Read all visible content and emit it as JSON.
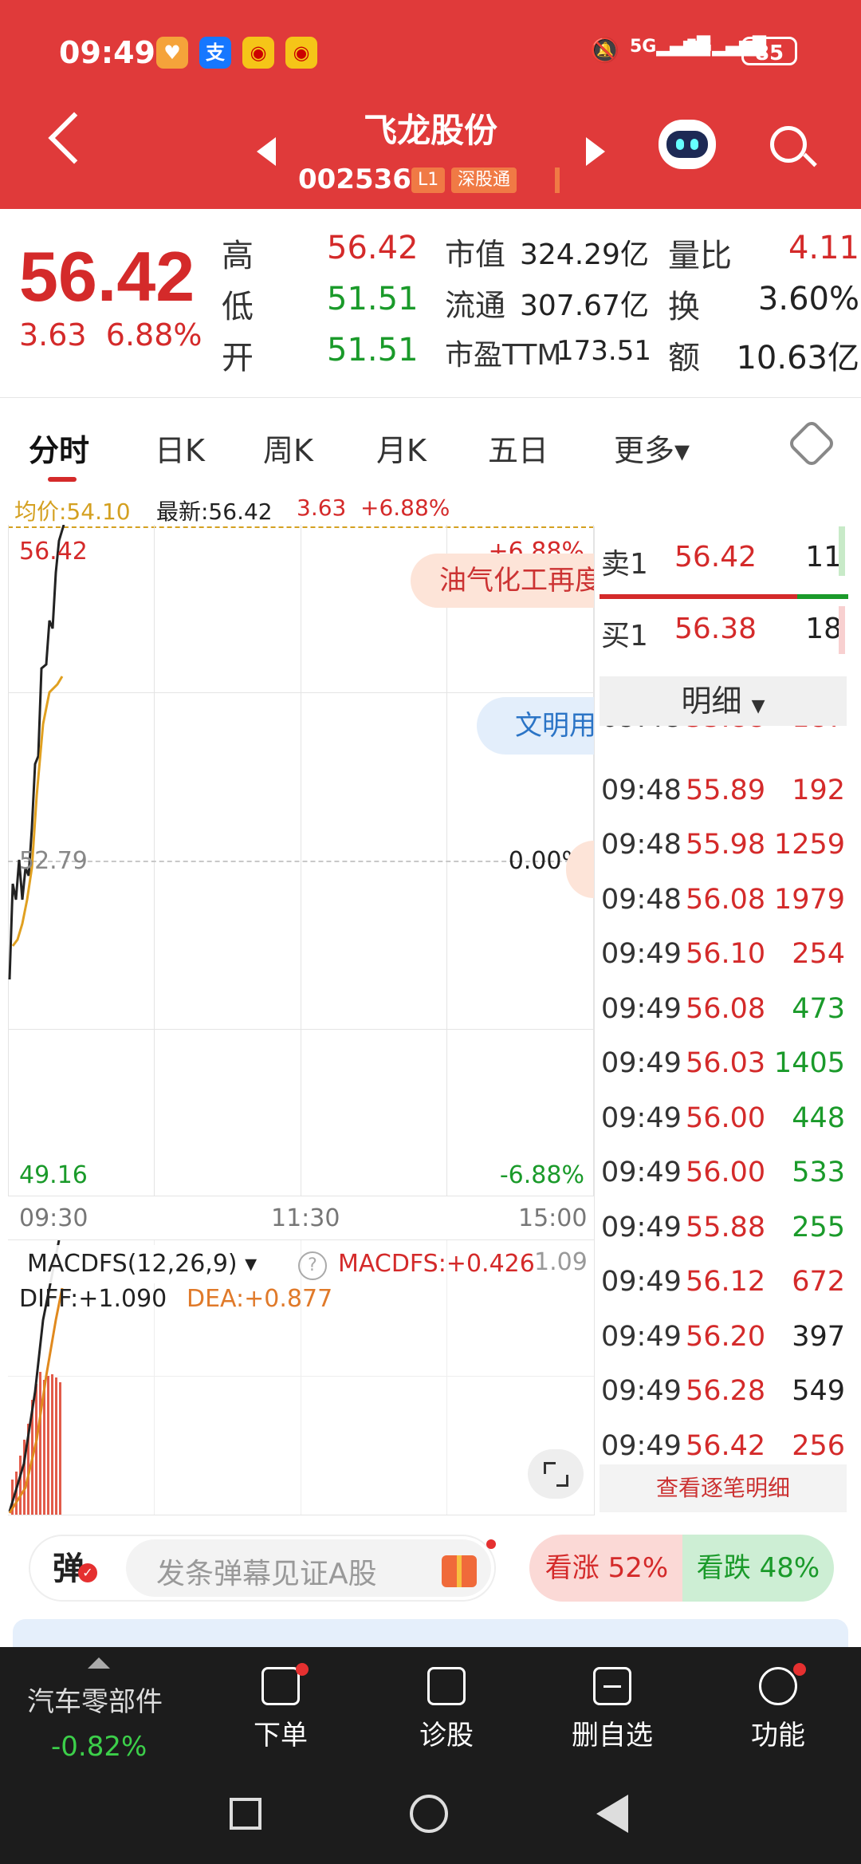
{
  "status": {
    "time": "09:49",
    "signal1": "5G",
    "signal2": "5G",
    "battery": "85",
    "app_icons": [
      "heart-icon",
      "alipay-icon",
      "weibo-icon",
      "weibo-icon"
    ]
  },
  "header": {
    "title": "飞龙股份",
    "code": "002536",
    "level_tag": "L1",
    "market_tag": "深股通"
  },
  "quote": {
    "price": "56.42",
    "change": "3.63",
    "change_pct": "6.88%",
    "rows": [
      {
        "l1": "高",
        "v1": "56.42",
        "l2": "市值",
        "v2": "324.29亿",
        "l3": "量比",
        "v3": "4.11"
      },
      {
        "l1": "低",
        "v1": "51.51",
        "l2": "流通",
        "v2": "307.67亿",
        "l3": "换",
        "v3": "3.60%"
      },
      {
        "l1": "开",
        "v1": "51.51",
        "l2": "市盈TTM",
        "v2": "173.51",
        "l3": "额",
        "v3": "10.63亿"
      }
    ]
  },
  "tabs": [
    "分时",
    "日K",
    "周K",
    "月K",
    "五日",
    "更多▾"
  ],
  "info": {
    "avg": "均价:54.10",
    "latest": "最新:56.42",
    "chg": "3.63",
    "pct": "+6.88%"
  },
  "chart": {
    "top_price": "56.42",
    "top_pct": "+6.88%",
    "mid_price": "52.79",
    "mid_pct": "0.00%",
    "bot_price": "49.16",
    "bot_pct": "-6.88%",
    "t_start": "09:30",
    "t_mid": "11:30",
    "t_end": "15:00",
    "banner1": "油气化工再度",
    "banner2": "文明用"
  },
  "macd": {
    "name": "MACDFS(12,26,9)",
    "value": "MACDFS:+0.426",
    "diff": "DIFF:+1.090",
    "dea": "DEA:+0.877",
    "right_val": "1.09"
  },
  "orderbook": {
    "sell": {
      "label": "卖1",
      "price": "56.42",
      "vol": "11"
    },
    "buy": {
      "label": "买1",
      "price": "56.38",
      "vol": "18"
    },
    "detail_btn": "明细",
    "view_all": "查看逐笔明细",
    "ticks": [
      {
        "t": "09:48",
        "p": "55.88",
        "v": "187",
        "c": "red"
      },
      {
        "t": "09:48",
        "p": "55.89",
        "v": "192",
        "c": "red"
      },
      {
        "t": "09:48",
        "p": "55.98",
        "v": "1259",
        "c": "red"
      },
      {
        "t": "09:48",
        "p": "56.08",
        "v": "1979",
        "c": "red"
      },
      {
        "t": "09:49",
        "p": "56.10",
        "v": "254",
        "c": "red"
      },
      {
        "t": "09:49",
        "p": "56.08",
        "v": "473",
        "c": "green"
      },
      {
        "t": "09:49",
        "p": "56.03",
        "v": "1405",
        "c": "green"
      },
      {
        "t": "09:49",
        "p": "56.00",
        "v": "448",
        "c": "green"
      },
      {
        "t": "09:49",
        "p": "56.00",
        "v": "533",
        "c": "green"
      },
      {
        "t": "09:49",
        "p": "55.88",
        "v": "255",
        "c": "green"
      },
      {
        "t": "09:49",
        "p": "56.12",
        "v": "672",
        "c": "red"
      },
      {
        "t": "09:49",
        "p": "56.20",
        "v": "397",
        "c": "black"
      },
      {
        "t": "09:49",
        "p": "56.28",
        "v": "549",
        "c": "black"
      },
      {
        "t": "09:49",
        "p": "56.42",
        "v": "256",
        "c": "red"
      }
    ]
  },
  "barrage": {
    "icon_label": "弹",
    "placeholder": "发条弹幕见证A股",
    "up": "看涨 52%",
    "down": "看跌 48%"
  },
  "bottom": {
    "sector": "汽车零部件",
    "sector_pct": "-0.82%",
    "items": [
      {
        "label": "下单",
        "icon": "order-icon"
      },
      {
        "label": "诊股",
        "icon": "diagnose-icon"
      },
      {
        "label": "删自选",
        "icon": "remove-watchlist-icon"
      },
      {
        "label": "功能",
        "icon": "function-icon"
      }
    ]
  },
  "colors": {
    "header": "#e03a3a",
    "up": "#d42a2a",
    "down": "#1a9a2a"
  }
}
